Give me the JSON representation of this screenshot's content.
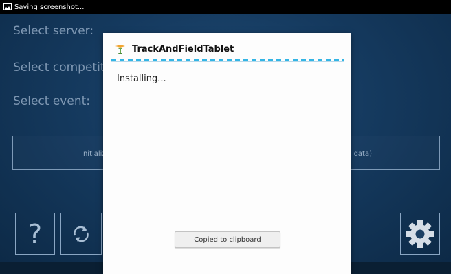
{
  "status_bar": {
    "text": "Saving screenshot..."
  },
  "main": {
    "select_server_label": "Select server:",
    "select_competition_label": "Select competit",
    "select_event_label": "Select event:",
    "init_button_left_text": "Initializ",
    "init_button_right_text": "cal data)",
    "help_button_label": "?"
  },
  "dialog": {
    "title": "TrackAndFieldTablet",
    "message": "Installing...",
    "toast_button_label": "Copied to clipboard"
  },
  "icons": {
    "status": "image-icon",
    "app": "app-logo-icon",
    "sync": "sync-icon",
    "settings": "gear-icon"
  },
  "colors": {
    "progress": "#33b5e5",
    "background": "#153a5f"
  }
}
